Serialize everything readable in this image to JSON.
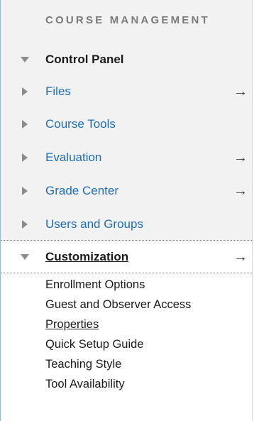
{
  "section_title": "COURSE MANAGEMENT",
  "items": [
    {
      "label": "Control Panel",
      "expanded": true,
      "has_arrow": false
    },
    {
      "label": "Files",
      "expanded": false,
      "has_arrow": true
    },
    {
      "label": "Course Tools",
      "expanded": false,
      "has_arrow": false
    },
    {
      "label": "Evaluation",
      "expanded": false,
      "has_arrow": true
    },
    {
      "label": "Grade Center",
      "expanded": false,
      "has_arrow": true
    },
    {
      "label": "Users and Groups",
      "expanded": false,
      "has_arrow": false
    },
    {
      "label": "Customization",
      "expanded": true,
      "has_arrow": true
    }
  ],
  "arrow_glyph": "→",
  "sub_items": [
    {
      "label": "Enrollment Options",
      "active": false
    },
    {
      "label": "Guest and Observer Access",
      "active": false
    },
    {
      "label": "Properties",
      "active": true
    },
    {
      "label": "Quick Setup Guide",
      "active": false
    },
    {
      "label": "Teaching Style",
      "active": false
    },
    {
      "label": "Tool Availability",
      "active": false
    }
  ],
  "colors": {
    "link": "#1f6eb5",
    "background": "#f2f2f2",
    "text": "#1a1a1a"
  },
  "icons": {
    "collapsed": "triangle-right-icon",
    "expanded": "triangle-down-icon"
  }
}
